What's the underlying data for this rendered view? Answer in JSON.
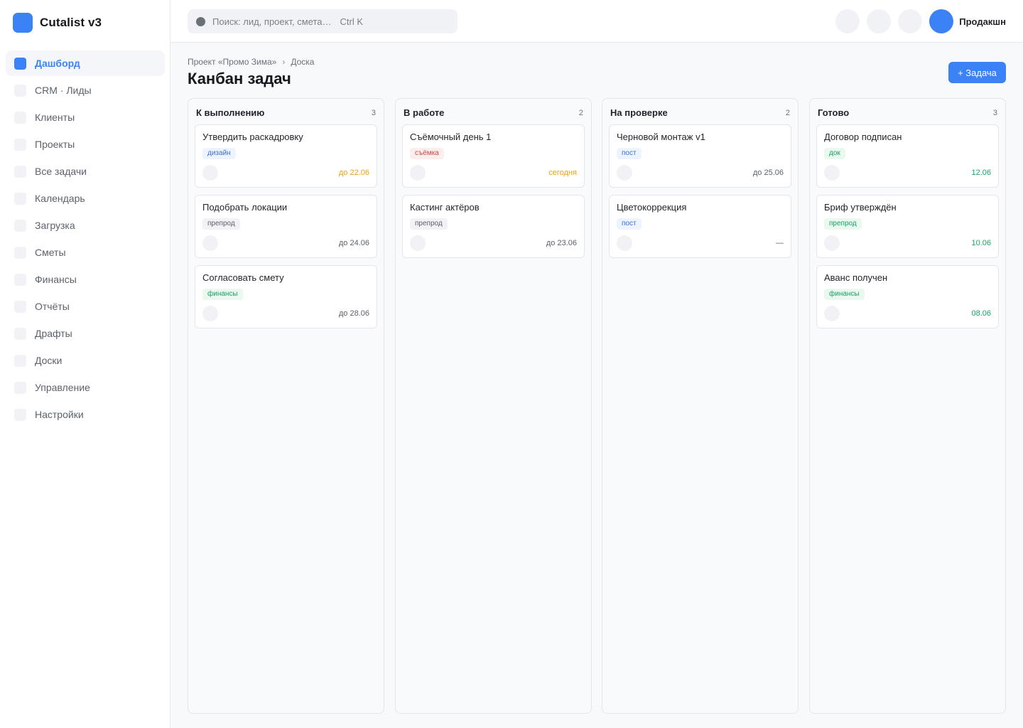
{
  "app": {
    "name": "Cutalist v3"
  },
  "sidebar": {
    "items": [
      {
        "label": "Дашборд",
        "active": true
      },
      {
        "label": "CRM · Лиды",
        "active": false
      },
      {
        "label": "Клиенты",
        "active": false
      },
      {
        "label": "Проекты",
        "active": false
      },
      {
        "label": "Все задачи",
        "active": false
      },
      {
        "label": "Календарь",
        "active": false
      },
      {
        "label": "Загрузка",
        "active": false
      },
      {
        "label": "Сметы",
        "active": false
      },
      {
        "label": "Финансы",
        "active": false
      },
      {
        "label": "Отчёты",
        "active": false
      },
      {
        "label": "Драфты",
        "active": false
      },
      {
        "label": "Доски",
        "active": false
      },
      {
        "label": "Управление",
        "active": false
      },
      {
        "label": "Настройки",
        "active": false
      }
    ]
  },
  "topbar": {
    "search_placeholder": "Поиск: лид, проект, смета…",
    "search_shortcut": "Ctrl K",
    "user_name": "Продакшн"
  },
  "header": {
    "breadcrumb": [
      "Проект «Промо Зима»",
      "Доска"
    ],
    "breadcrumb_separator": "›",
    "title": "Канбан задач",
    "add_button": "+ Задача"
  },
  "colors": {
    "accent": "#3b82f6",
    "due_soon": "#e8a317",
    "done": "#1aa364",
    "tag_design_bg": "#eef4ff",
    "tag_design_fg": "#3b6fd1",
    "tag_prep_bg": "#f1f2f5",
    "tag_prep_fg": "#5b616b",
    "tag_fin_bg": "#eaf8f0",
    "tag_fin_fg": "#1aa364",
    "tag_shoot_bg": "#fdeeee",
    "tag_shoot_fg": "#d64545",
    "tag_post_bg": "#eef4ff",
    "tag_post_fg": "#3b6fd1"
  },
  "board": {
    "columns": [
      {
        "title": "К выполнению",
        "count": "3",
        "cards": [
          {
            "title": "Утвердить раскадровку",
            "tag": "дизайн",
            "tag_kind": "design",
            "due": "до 22.06",
            "due_kind": "soon"
          },
          {
            "title": "Подобрать локации",
            "tag": "препрод",
            "tag_kind": "prep",
            "due": "до 24.06",
            "due_kind": "normal"
          },
          {
            "title": "Согласовать смету",
            "tag": "финансы",
            "tag_kind": "fin",
            "due": "до 28.06",
            "due_kind": "normal"
          }
        ]
      },
      {
        "title": "В работе",
        "count": "2",
        "cards": [
          {
            "title": "Съёмочный день 1",
            "tag": "съёмка",
            "tag_kind": "shoot",
            "due": "сегодня",
            "due_kind": "soon"
          },
          {
            "title": "Кастинг актёров",
            "tag": "препрод",
            "tag_kind": "prep",
            "due": "до 23.06",
            "due_kind": "normal"
          }
        ]
      },
      {
        "title": "На проверке",
        "count": "2",
        "cards": [
          {
            "title": "Черновой монтаж v1",
            "tag": "пост",
            "tag_kind": "post",
            "due": "до 25.06",
            "due_kind": "normal"
          },
          {
            "title": "Цветокоррекция",
            "tag": "пост",
            "tag_kind": "post",
            "due": "—",
            "due_kind": "normal"
          }
        ]
      },
      {
        "title": "Готово",
        "count": "3",
        "cards": [
          {
            "title": "Договор подписан",
            "tag": "док",
            "tag_kind": "fin",
            "due": "12.06",
            "due_kind": "done"
          },
          {
            "title": "Бриф утверждён",
            "tag": "препрод",
            "tag_kind": "fin",
            "due": "10.06",
            "due_kind": "done"
          },
          {
            "title": "Аванс получен",
            "tag": "финансы",
            "tag_kind": "fin",
            "due": "08.06",
            "due_kind": "done"
          }
        ]
      }
    ]
  }
}
